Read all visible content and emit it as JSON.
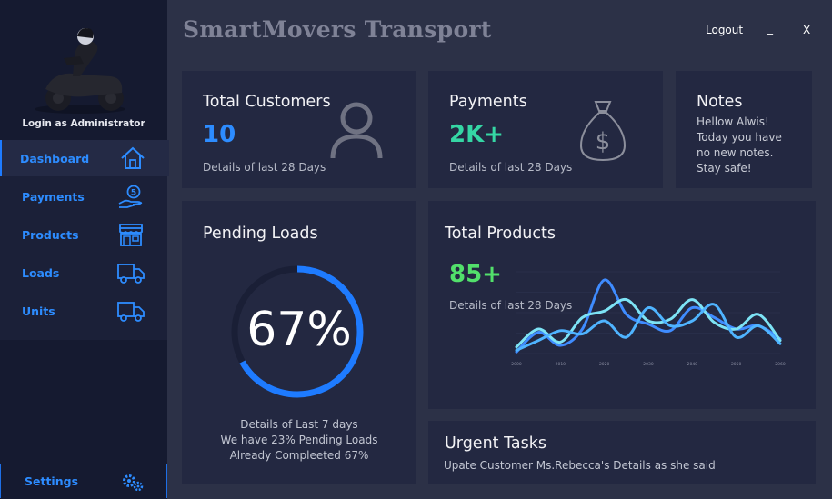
{
  "app": {
    "title": "SmartMovers Transport"
  },
  "window": {
    "logout": "Logout",
    "minimize": "_",
    "close": "X"
  },
  "sidebar": {
    "login_label": "Login as Administrator",
    "items": [
      {
        "label": "Dashboard",
        "icon": "home-icon",
        "active": true
      },
      {
        "label": "Payments",
        "icon": "payment-hand-icon"
      },
      {
        "label": "Products",
        "icon": "store-icon"
      },
      {
        "label": "Loads",
        "icon": "truck-icon"
      },
      {
        "label": "Units",
        "icon": "truck-icon"
      }
    ],
    "settings_label": "Settings",
    "settings_icon": "gears-icon"
  },
  "cards": {
    "customers": {
      "title": "Total Customers",
      "value": "10",
      "sub": "Details of last 28 Days",
      "icon": "user-icon",
      "value_color": "#2d8cff"
    },
    "payments": {
      "title": "Payments",
      "value": "2K+",
      "sub": "Details of last 28 Days",
      "icon": "money-bag-icon",
      "value_color": "#35d6a4"
    },
    "notes": {
      "title": "Notes",
      "lines": [
        "Hellow Alwis!",
        "Today you have",
        "no new notes.",
        "Stay safe!"
      ]
    },
    "pending": {
      "title": "Pending Loads",
      "percent_label": "67%",
      "percent": 67,
      "lines": [
        "Details of Last 7 days",
        "We have 23% Pending Loads",
        "Already Compleeted 67%"
      ]
    },
    "products": {
      "title": "Total Products",
      "value": "85+",
      "sub": "Details of last 28 Days",
      "value_color": "#52e06b"
    },
    "urgent": {
      "title": "Urgent Tasks",
      "text": "Upate Customer Ms.Rebecca's Details as she said"
    }
  },
  "colors": {
    "accent": "#1e7bff",
    "sidebar": "#151a30",
    "card": "#232841",
    "background": "#2c3147"
  },
  "chart_data": {
    "type": "line",
    "x": [
      2000,
      2005,
      2010,
      2015,
      2020,
      2025,
      2030,
      2035,
      2040,
      2045,
      2050,
      2055,
      2060
    ],
    "x_ticks": [
      "2000",
      "2010",
      "2020",
      "2030",
      "2040",
      "2050",
      "2060"
    ],
    "series": [
      {
        "color": "#3f8cff",
        "values": [
          2,
          26,
          10,
          30,
          90,
          48,
          36,
          28,
          56,
          44,
          30,
          34,
          18
        ]
      },
      {
        "color": "#7de3f5",
        "values": [
          8,
          30,
          14,
          44,
          52,
          66,
          40,
          42,
          66,
          38,
          30,
          48,
          16
        ]
      },
      {
        "color": "#4fb4ff",
        "values": [
          4,
          16,
          28,
          24,
          40,
          20,
          56,
          34,
          40,
          60,
          20,
          34,
          12
        ]
      }
    ],
    "ylim": [
      0,
      100
    ],
    "grid": true
  }
}
